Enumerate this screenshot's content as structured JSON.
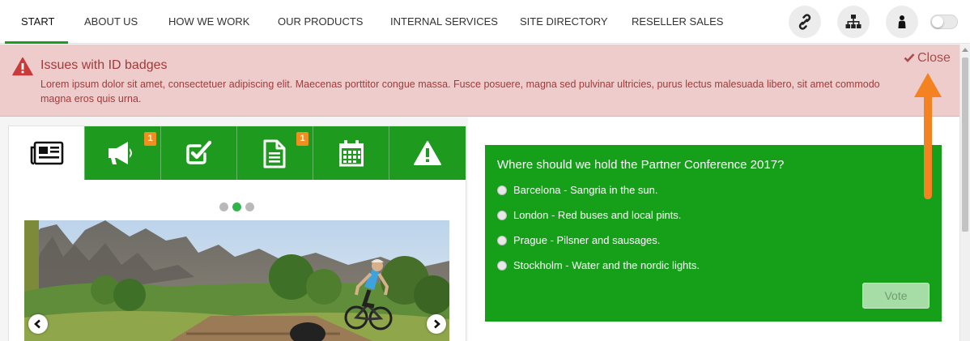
{
  "nav": {
    "items": [
      {
        "label": "START"
      },
      {
        "label": "ABOUT US"
      },
      {
        "label": "HOW WE WORK"
      },
      {
        "label": "OUR PRODUCTS"
      },
      {
        "label": "INTERNAL SERVICES"
      },
      {
        "label": "SITE DIRECTORY"
      },
      {
        "label": "RESELLER SALES"
      }
    ],
    "active_index": 0,
    "icons": [
      "link-icon",
      "sitemap-icon",
      "user-icon"
    ],
    "toggle_on": false
  },
  "alert": {
    "icon": "warning-icon",
    "title": "Issues with ID badges",
    "body": "Lorem ipsum dolor sit amet, consectetuer adipiscing elit. Maecenas porttitor congue massa. Fusce posuere, magna sed pulvinar ultricies, purus lectus malesuada libero, sit amet commodo magna eros quis urna.",
    "close_label": "Close"
  },
  "tabs": [
    {
      "icon": "newspaper-icon",
      "badge": ""
    },
    {
      "icon": "megaphone-icon",
      "badge": "1"
    },
    {
      "icon": "checkbox-icon",
      "badge": ""
    },
    {
      "icon": "document-icon",
      "badge": "1"
    },
    {
      "icon": "calendar-icon",
      "badge": ""
    },
    {
      "icon": "warning-icon",
      "badge": ""
    }
  ],
  "carousel": {
    "slide_count": 3,
    "active_index": 1
  },
  "poll": {
    "question": "Where should we hold the Partner Conference 2017?",
    "options": [
      {
        "label": "Barcelona - Sangria in the sun."
      },
      {
        "label": "London - Red buses and local pints."
      },
      {
        "label": "Prague - Pilsner and sausages."
      },
      {
        "label": "Stockholm - Water and the nordic lights."
      }
    ],
    "vote_label": "Vote"
  },
  "colors": {
    "brand_green": "#1e9a1e",
    "alert_bg": "#efcccc",
    "alert_text": "#a33a3a",
    "badge_orange": "#ef8f1f",
    "annotation_arrow": "#f58220"
  }
}
